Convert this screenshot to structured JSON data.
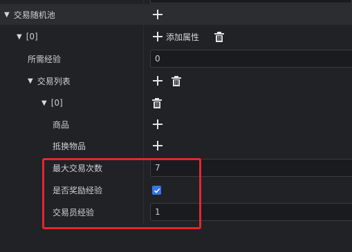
{
  "tree": {
    "root_label": "交易随机池",
    "item_index_label": "[0]",
    "add_property_label": "添加属性",
    "required_exp_label": "所需经验",
    "required_exp_value": "0",
    "trade_list_label": "交易列表",
    "trade_index_label": "[0]",
    "goods_label": "商品",
    "exchange_item_label": "抵换物品",
    "max_trades_label": "最大交易次数",
    "max_trades_value": "7",
    "reward_exp_label": "是否奖励经验",
    "reward_exp_checked": true,
    "trader_exp_label": "交易员经验",
    "trader_exp_value": "1"
  },
  "colors": {
    "highlight": "#e8262b",
    "checkbox": "#3574f0"
  },
  "icons": [
    "plus-icon",
    "trash-icon",
    "expand-triangle-icon",
    "check-icon"
  ]
}
